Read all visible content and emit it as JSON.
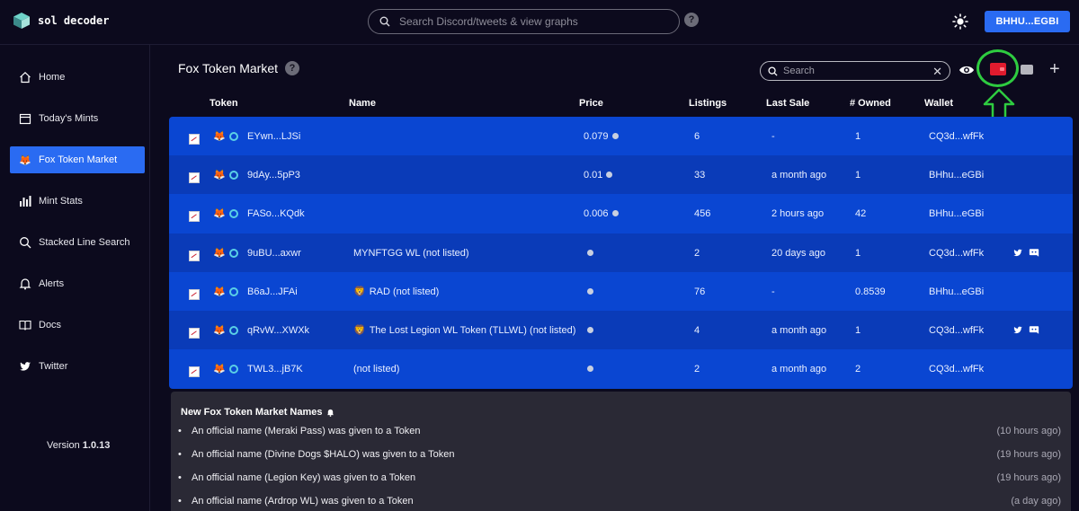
{
  "app": {
    "name": "sol decoder",
    "search_placeholder": "Search Discord/tweets & view graphs",
    "help_label": "?",
    "wallet_button": "BHHU...EGBI"
  },
  "sidebar": {
    "items": [
      {
        "label": "Home",
        "icon": "home-icon"
      },
      {
        "label": "Today's Mints",
        "icon": "calendar-icon"
      },
      {
        "label": "Fox Token Market",
        "icon": "fox-icon",
        "active": true
      },
      {
        "label": "Mint Stats",
        "icon": "bar-chart-icon"
      },
      {
        "label": "Stacked Line Search",
        "icon": "search-icon"
      },
      {
        "label": "Alerts",
        "icon": "bell-icon"
      },
      {
        "label": "Docs",
        "icon": "book-icon"
      },
      {
        "label": "Twitter",
        "icon": "twitter-icon"
      }
    ],
    "version_label": "Version",
    "version_number": "1.0.13"
  },
  "main": {
    "title": "Fox Token Market",
    "help_label": "?",
    "search_placeholder": "Search",
    "clear_label": "✕",
    "plus_label": "+",
    "columns": [
      "Token",
      "Name",
      "Price",
      "Listings",
      "Last Sale",
      "# Owned",
      "Wallet"
    ],
    "rows": [
      {
        "token": "EYwn...LJSi",
        "name": "",
        "price": "0.079",
        "listings": "6",
        "last_sale": "-",
        "owned": "1",
        "wallet": "CQ3d...wfFk",
        "social": false,
        "lion": false
      },
      {
        "token": "9dAy...5pP3",
        "name": "",
        "price": "0.01",
        "listings": "33",
        "last_sale": "a month ago",
        "owned": "1",
        "wallet": "BHhu...eGBi",
        "social": false,
        "lion": false
      },
      {
        "token": "FASo...KQdk",
        "name": "",
        "price": "0.006",
        "listings": "456",
        "last_sale": "2 hours ago",
        "owned": "42",
        "wallet": "BHhu...eGBi",
        "social": false,
        "lion": false
      },
      {
        "token": "9uBU...axwr",
        "name": "MYNFTGG WL (not listed)",
        "price": "",
        "listings": "2",
        "last_sale": "20 days ago",
        "owned": "1",
        "wallet": "CQ3d...wfFk",
        "social": true,
        "lion": false
      },
      {
        "token": "B6aJ...JFAi",
        "name": "RAD (not listed)",
        "price": "",
        "listings": "76",
        "last_sale": "-",
        "owned": "0.8539",
        "wallet": "BHhu...eGBi",
        "social": false,
        "lion": true
      },
      {
        "token": "qRvW...XWXk",
        "name": "The Lost Legion WL Token (TLLWL) (not listed)",
        "price": "",
        "listings": "4",
        "last_sale": "a month ago",
        "owned": "1",
        "wallet": "CQ3d...wfFk",
        "social": true,
        "lion": true
      },
      {
        "token": "TWL3...jB7K",
        "name": "(not listed)",
        "price": "",
        "listings": "2",
        "last_sale": "a month ago",
        "owned": "2",
        "wallet": "CQ3d...wfFk",
        "social": false,
        "lion": false
      }
    ]
  },
  "names_panel": {
    "title": "New Fox Token Market Names",
    "items": [
      {
        "text": "An official name (Meraki Pass) was given to a Token",
        "time": "(10 hours ago)"
      },
      {
        "text": "An official name (Divine Dogs $HALO) was given to a Token",
        "time": "(19 hours ago)"
      },
      {
        "text": "An official name (Legion Key) was given to a Token",
        "time": "(19 hours ago)"
      },
      {
        "text": "An official name (Ardrop WL) was given to a Token",
        "time": "(a day ago)"
      }
    ]
  },
  "colors": {
    "background": "#0c0a1d",
    "accent": "#2a6bf2",
    "table_row": "#0a46d2",
    "table_row_alt": "#0a3bb8",
    "highlight_circle": "#2ecc40",
    "wallet_red": "#e01b2e"
  }
}
